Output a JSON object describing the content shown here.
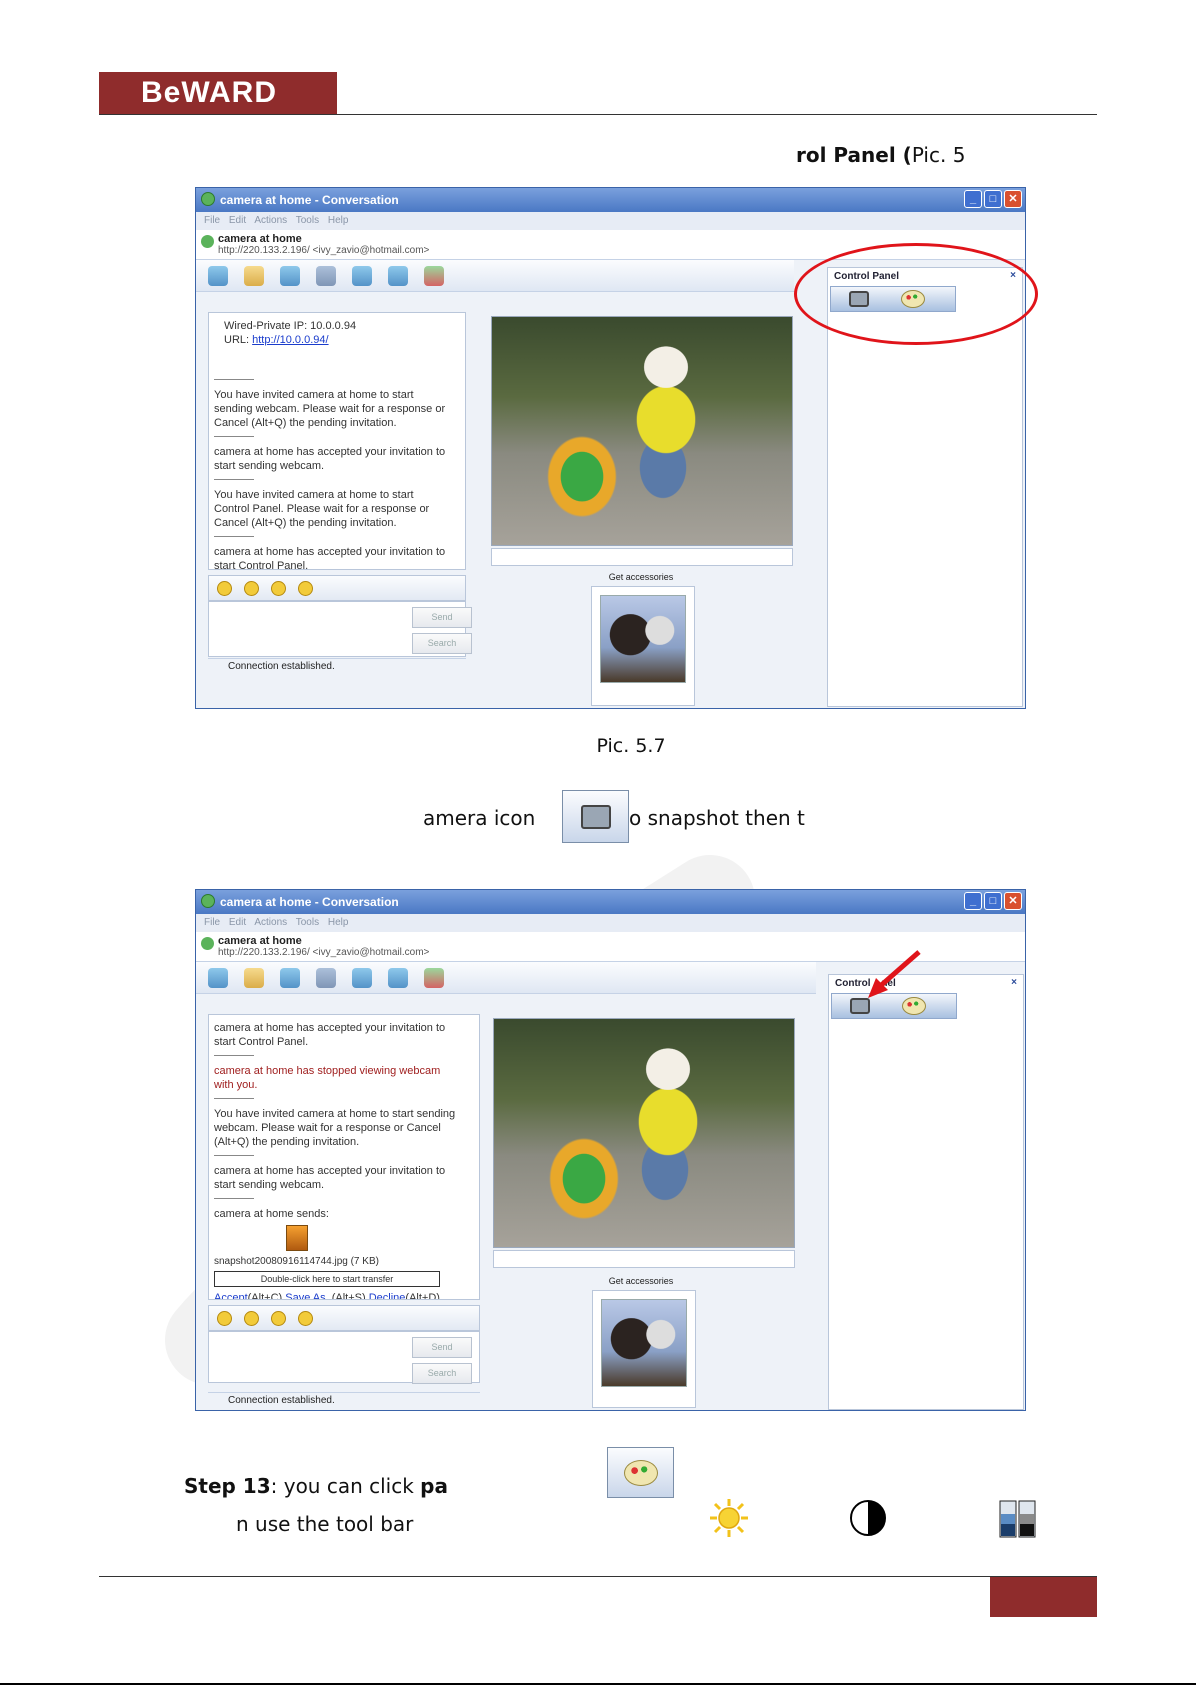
{
  "header": {
    "logo_text": "BeWARD"
  },
  "intro_line": {
    "bold": "rol Panel (",
    "normal": "Pic. 5"
  },
  "caption1": "Pic. 5.7",
  "camera_line": {
    "bold": "amera icon",
    "normal": "o snapshot then t"
  },
  "window": {
    "title": "camera at home - Conversation",
    "menu": "File Edit Actions Tools Help",
    "contact_name": "camera at home",
    "contact_url": "http://220.133.2.196/ <ivy_zavio@hotmail.com>",
    "send_label": "Send",
    "search_label": "Search",
    "status": "Connection established.",
    "accessories": "Get accessories",
    "control_panel_title": "Control Panel",
    "control_panel_title_partial": "Control",
    "control_panel_title_partial_2": "nel",
    "close_glyph": "×"
  },
  "chat1": {
    "ip": "Wired-Private IP: 10.0.0.94",
    "url_label": "URL:",
    "url": "http://10.0.0.94/",
    "messages": [
      "You have invited camera at home to start sending webcam. Please wait for a response or Cancel (Alt+Q) the pending invitation.",
      "camera at home has accepted your invitation to start sending webcam.",
      "You have invited camera at home to start Control Panel. Please wait for a response or Cancel (Alt+Q) the pending invitation.",
      "camera at home has accepted your invitation to start Control Panel."
    ]
  },
  "chat2": {
    "messages": [
      "camera at home has accepted your invitation to start Control Panel.",
      "camera at home has stopped viewing webcam with you.",
      "You have invited camera at home to start sending webcam. Please wait for a response or Cancel (Alt+Q) the pending invitation.",
      "camera at home has accepted your invitation to start sending webcam."
    ],
    "sends": "camera at home sends:",
    "file": "snapshot20080916114744.jpg (7 KB)",
    "transfer": "Double-click here to start transfer",
    "accept": "Accept",
    "accept_key": "(Alt+C)",
    "saveas": "Save As..",
    "saveas_key": "(Alt+S)",
    "decline": "Decline",
    "decline_key": "(Alt+D)"
  },
  "step13": {
    "bold": "Step 13",
    "text": ": you can click ",
    "bold2": "pa",
    "line2": "n use the tool bar"
  },
  "colors": {
    "brand": "#8f2c2c",
    "highlight": "#e0141a"
  }
}
